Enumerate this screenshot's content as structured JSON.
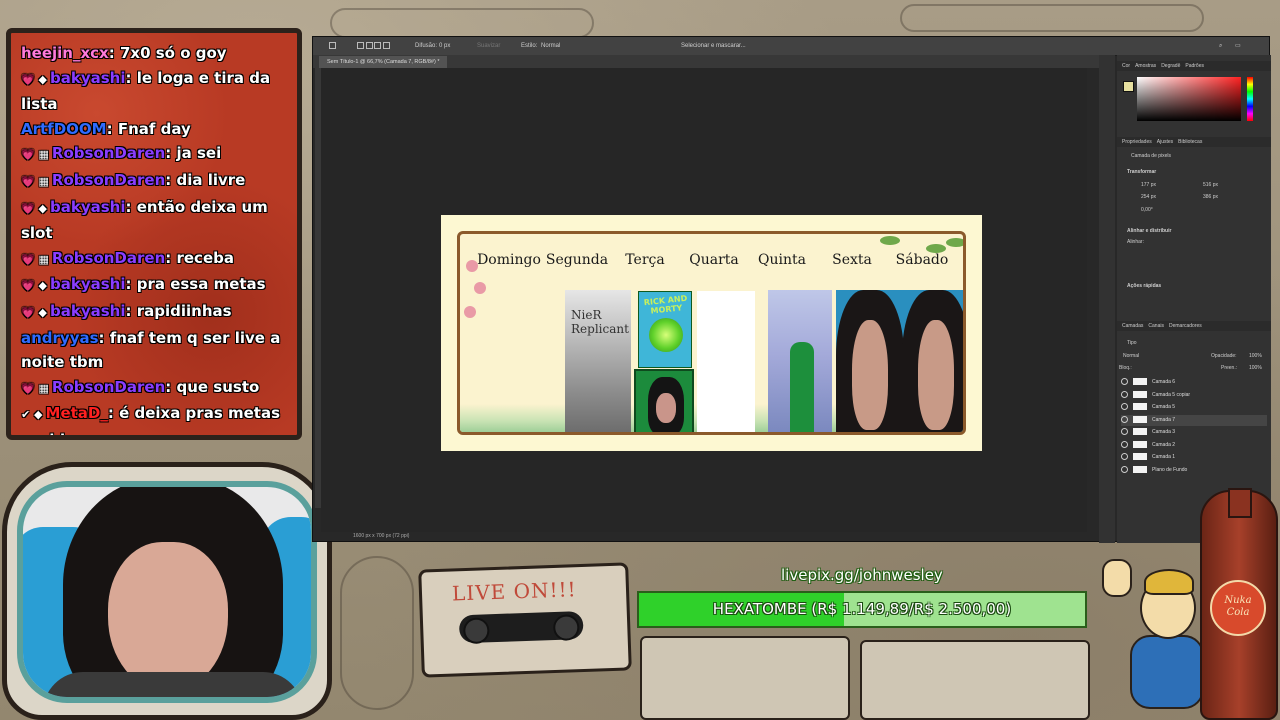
{
  "chat": {
    "messages": [
      {
        "badges": "",
        "user": "heejin_xcx",
        "text": "7x0 só o goy",
        "color": "u-pink"
      },
      {
        "badges": "💗 ◆",
        "user": "bakyashi",
        "text": "le loga e tira da lista",
        "color": "u-purple"
      },
      {
        "badges": "",
        "user": "ArtfDOOM",
        "text": "Fnaf day",
        "color": "u-blue"
      },
      {
        "badges": "💗 ▦",
        "user": "RobsonDaren",
        "text": "ja sei",
        "color": "u-purple"
      },
      {
        "badges": "💗 ▦",
        "user": "RobsonDaren",
        "text": "dia livre",
        "color": "u-purple"
      },
      {
        "badges": "💗 ◆",
        "user": "bakyashi",
        "text": "então deixa um slot",
        "color": "u-purple"
      },
      {
        "badges": "💗 ▦",
        "user": "RobsonDaren",
        "text": "receba",
        "color": "u-purple"
      },
      {
        "badges": "💗 ◆",
        "user": "bakyashi",
        "text": "pra essa metas",
        "color": "u-purple"
      },
      {
        "badges": "💗 ◆",
        "user": "bakyashi",
        "text": "rapidiinhas",
        "color": "u-purple"
      },
      {
        "badges": "",
        "user": "andryyas",
        "text": "fnaf tem q ser live a noite tbm",
        "color": "u-blue"
      },
      {
        "badges": "💗 ▦",
        "user": "RobsonDaren",
        "text": "que susto",
        "color": "u-purple"
      },
      {
        "badges": "✔ ◆",
        "user": "MetaD_",
        "text": "é deixa pras metas rapidas",
        "color": "u-red"
      }
    ]
  },
  "photoshop": {
    "options": {
      "difusao_label": "Difusão:",
      "difusao_value": "0 px",
      "suavizar": "Suavizar",
      "estilo_label": "Estilo:",
      "estilo_value": "Normal",
      "select_mask": "Selecionar e mascarar..."
    },
    "doc_tab": "Sem Título-1 @ 66,7% (Camada 7, RGB/8#) *",
    "status": "1600 px x 700 px (72 ppi)",
    "schedule": {
      "days": [
        "Domingo",
        "Segunda",
        "Terça",
        "Quarta",
        "Quinta",
        "Sexta",
        "Sábado"
      ],
      "segunda_art_text": "NieR Replicant",
      "terca_top_title": "RICK AND MORTY"
    },
    "panel": {
      "color_tabs": [
        "Cor",
        "Amostras",
        "Degradê",
        "Padrões"
      ],
      "prop_tabs": [
        "Propriedades",
        "Ajustes",
        "Bibliotecas"
      ],
      "pixel_layer": "Camada de pixels",
      "transform_label": "Transformar",
      "w": "177 px",
      "h": "254 px",
      "x": "516 px",
      "y": "386 px",
      "angle": "0,00°",
      "align_label": "Alinhar e distribuir",
      "align_sub": "Alinhar:",
      "quick_actions": "Ações rápidas",
      "layer_tabs": [
        "Camadas",
        "Canais",
        "Demarcadores"
      ],
      "kind": "Tipo",
      "blend": "Normal",
      "opacity_label": "Opacidade:",
      "opacity_value": "100%",
      "lock_label": "Bloq.:",
      "fill_label": "Preen.:",
      "fill_value": "100%",
      "layers": [
        "Camada 6",
        "Camada 5 copiar",
        "Camada 5",
        "Camada 7",
        "Camada 3",
        "Camada 2",
        "Camada 1",
        "Plano de Fundo"
      ],
      "selected_layer_index": 3
    }
  },
  "cassette_label": "LIVE ON!!!",
  "livepix": {
    "url": "livepix.gg/johnwesley",
    "goal_text": "HEXATOMBE (R$ 1.149,89/R$ 2.500,00)",
    "progress": 0.46
  },
  "bottle_label": "Nuka Cola",
  "colors": {
    "chat_bg": "#b83a24",
    "goal_fill": "#2fd12a",
    "ps_bg": "#282828",
    "doc_bg": "#fdf8d2"
  }
}
